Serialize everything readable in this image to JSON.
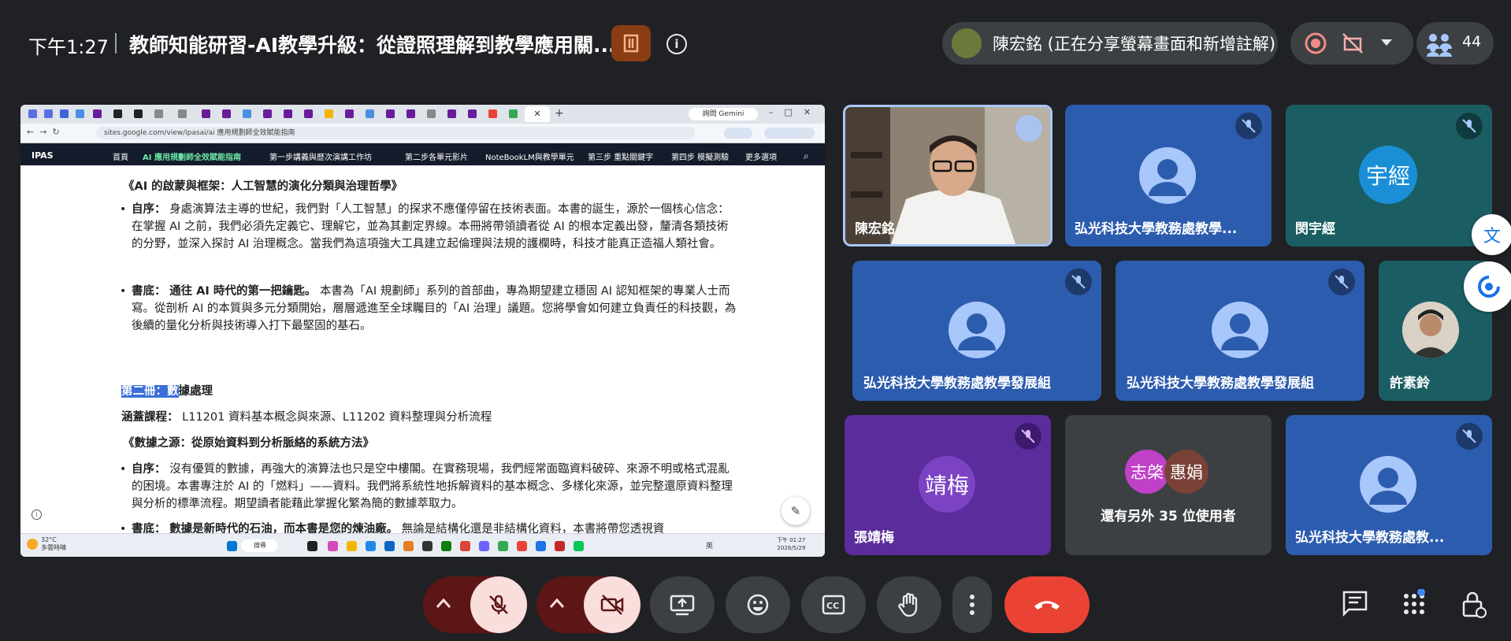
{
  "topbar": {
    "time": "下午1:27",
    "meeting_title": "教師知能研習-AI教學升級：從證照理解到教學應用關...",
    "presenter_label": "陳宏銘 (正在分享螢幕畫面和新增註解)",
    "participant_count": "44"
  },
  "shared_screen": {
    "url": "sites.google.com/view/ipasai/ai 應用規劃師全效賦能指南",
    "gemini_label": "詢問 Gemini",
    "site_logo": "IPAS",
    "nav": [
      "首頁",
      "AI 應用規劃師全效賦能指南",
      "第一步講義與歷次演講工作坊",
      "第二步各單元影片",
      "NoteBookLM與教學單元",
      "第三步 重點關鍵字",
      "第四步 模擬測驗",
      "更多選項"
    ],
    "heading1": "《AI 的啟蒙與框架：人工智慧的演化分類與治理哲學》",
    "p1_label": "自序：",
    "p1_text": "身處演算法主導的世紀，我們對「人工智慧」的探求不應僅停留在技術表面。本書的誕生，源於一個核心信念：在掌握 AI 之前，我們必須先定義它、理解它，並為其劃定界線。本冊將帶領讀者從 AI 的根本定義出發，釐清各類技術的分野，並深入探討 AI 治理概念。當我們為這項強大工具建立起倫理與法規的護欄時，科技才能真正造福人類社會。",
    "p2_label": "書底：",
    "p2_bold": "通往 AI 時代的第一把鑰匙。",
    "p2_text": "本書為「AI 規劃師」系列的首部曲，專為期望建立穩固 AI 認知框架的專業人士而寫。從剖析 AI 的本質與多元分類開始，層層遞進至全球矚目的「AI 治理」議題。您將學會如何建立負責任的科技觀，為後續的量化分析與技術導入打下最堅固的基石。",
    "vol2_hl": "第二冊：數",
    "vol2_rest": "據處理",
    "covers_label": "涵蓋課程：",
    "covers_text": "L11201 資料基本概念與來源、L11202 資料整理與分析流程",
    "heading2": "《數據之源：從原始資料到分析脈絡的系統方法》",
    "p3_label": "自序：",
    "p3_text": "沒有優質的數據，再強大的演算法也只是空中樓閣。在實務現場，我們經常面臨資料破碎、來源不明或格式混亂的困境。本書專注於 AI 的「燃料」——資料。我們將系統性地拆解資料的基本概念、多樣化來源，並完整還原資料整理與分析的標準流程。期望讀者能藉此掌握化繁為簡的數據萃取力。",
    "p4_label": "書底：",
    "p4_bold": "數據是新時代的石油，而本書是您的煉油廠。",
    "p4_text": "無論是結構化還是非結構化資料，本書將帶您透視資",
    "weather_temp": "32°C",
    "weather_desc": "多雲時晴",
    "search_label": "搜尋",
    "lang": "英",
    "clock_time": "下午 01:27",
    "clock_date": "2026/5/29"
  },
  "tiles": [
    {
      "name": "陳宏銘"
    },
    {
      "name": "弘光科技大學教務處教學..."
    },
    {
      "name": "閔宇經",
      "initials": "宇經"
    },
    {
      "name": "弘光科技大學教務處教學發展組"
    },
    {
      "name": "弘光科技大學教務處教學發展組"
    },
    {
      "name": "許素鈴"
    },
    {
      "name": "張靖梅",
      "initials": "靖梅"
    },
    {
      "others_a": "志棨",
      "others_b": "惠娟",
      "others_text": "還有另外 35 位使用者"
    },
    {
      "name": "弘光科技大學教務處教..."
    }
  ],
  "colors": {
    "accent_red": "#ea4335",
    "tile_blue": "#2c5cae",
    "highlight": "#3a6fd8"
  }
}
